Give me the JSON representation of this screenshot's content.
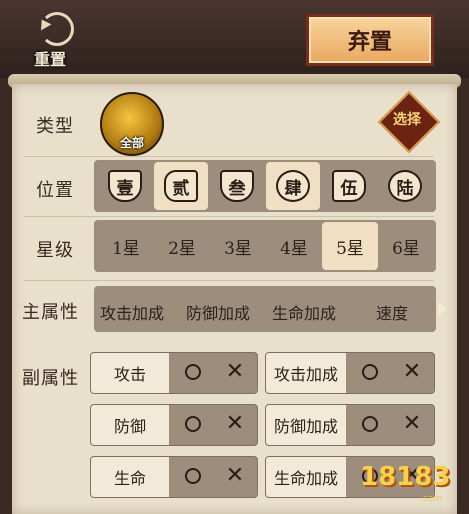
{
  "header": {
    "reset_label": "重置",
    "discard_label": "弃置"
  },
  "filters": {
    "type": {
      "label": "类型",
      "selected": "全部",
      "choose_label": "选择"
    },
    "position": {
      "label": "位置",
      "options": [
        "壹",
        "贰",
        "叁",
        "肆",
        "伍",
        "陆"
      ],
      "selected": [
        "贰",
        "肆"
      ]
    },
    "star": {
      "label": "星级",
      "options": [
        "1星",
        "2星",
        "3星",
        "4星",
        "5星",
        "6星"
      ],
      "selected": "5星"
    },
    "main_attr": {
      "label": "主属性",
      "options": [
        "攻击加成",
        "防御加成",
        "生命加成",
        "速度"
      ]
    },
    "sub_attr": {
      "label": "副属性",
      "items": [
        "攻击",
        "攻击加成",
        "防御",
        "防御加成",
        "生命",
        "生命加成"
      ]
    }
  },
  "watermark": {
    "text": "18183",
    "sub": ".com"
  },
  "colors": {
    "panel_bg": "#e9e0cc",
    "strip_bg": "#9c8d7d",
    "selected_bg": "#f0dfc2",
    "discard_bg": "#f2c07c",
    "discard_border": "#7a2c1a"
  }
}
